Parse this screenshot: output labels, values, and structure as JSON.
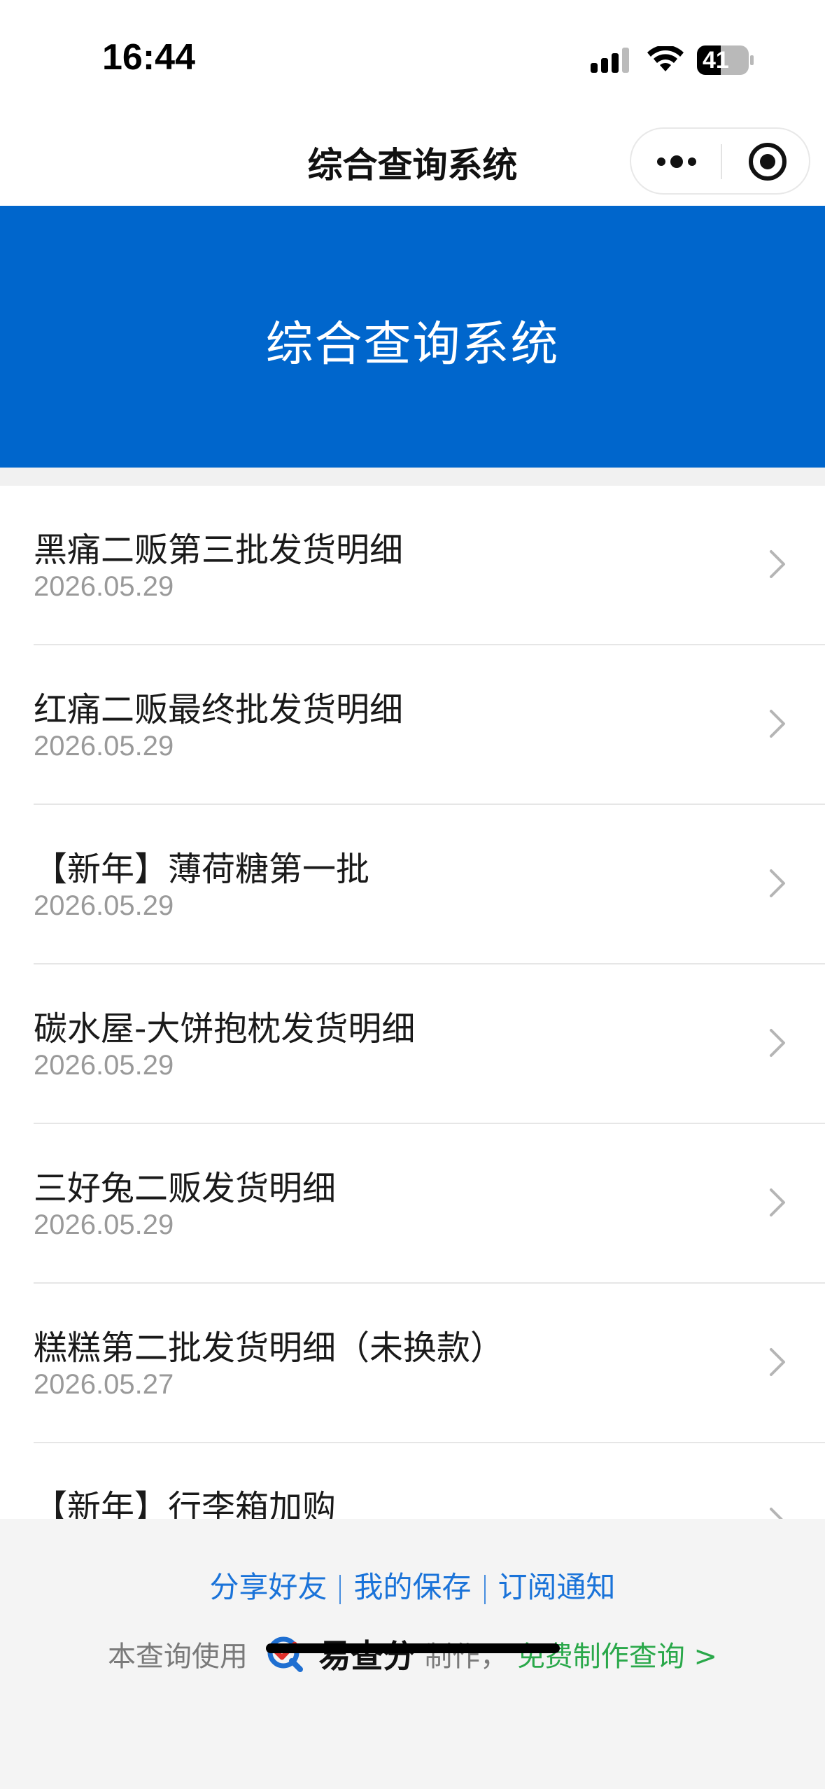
{
  "status_bar": {
    "time": "16:44",
    "battery": "41"
  },
  "nav": {
    "title": "综合查询系统"
  },
  "banner": {
    "title": "综合查询系统",
    "color": "#0066cc"
  },
  "list": {
    "items": [
      {
        "title": "黑痛二贩第三批发货明细",
        "date": "2026.05.29"
      },
      {
        "title": "红痛二贩最终批发货明细",
        "date": "2026.05.29"
      },
      {
        "title": "【新年】薄荷糖第一批",
        "date": "2026.05.29"
      },
      {
        "title": "碳水屋-大饼抱枕发货明细",
        "date": "2026.05.29"
      },
      {
        "title": "三好兔二贩发货明细",
        "date": "2026.05.29"
      },
      {
        "title": "糕糕第二批发货明细（未换款）",
        "date": "2026.05.27"
      },
      {
        "title": "【新年】行李箱加购",
        "date": ""
      }
    ]
  },
  "footer": {
    "links": [
      "分享好友",
      "我的保存",
      "订阅通知"
    ],
    "credit_prefix": "本查询使用",
    "brand": "易查分",
    "credit_suffix": "制作，",
    "free_link": "免费制作查询 >",
    "link_color": "#1a73d9",
    "free_color": "#2aa84a"
  }
}
